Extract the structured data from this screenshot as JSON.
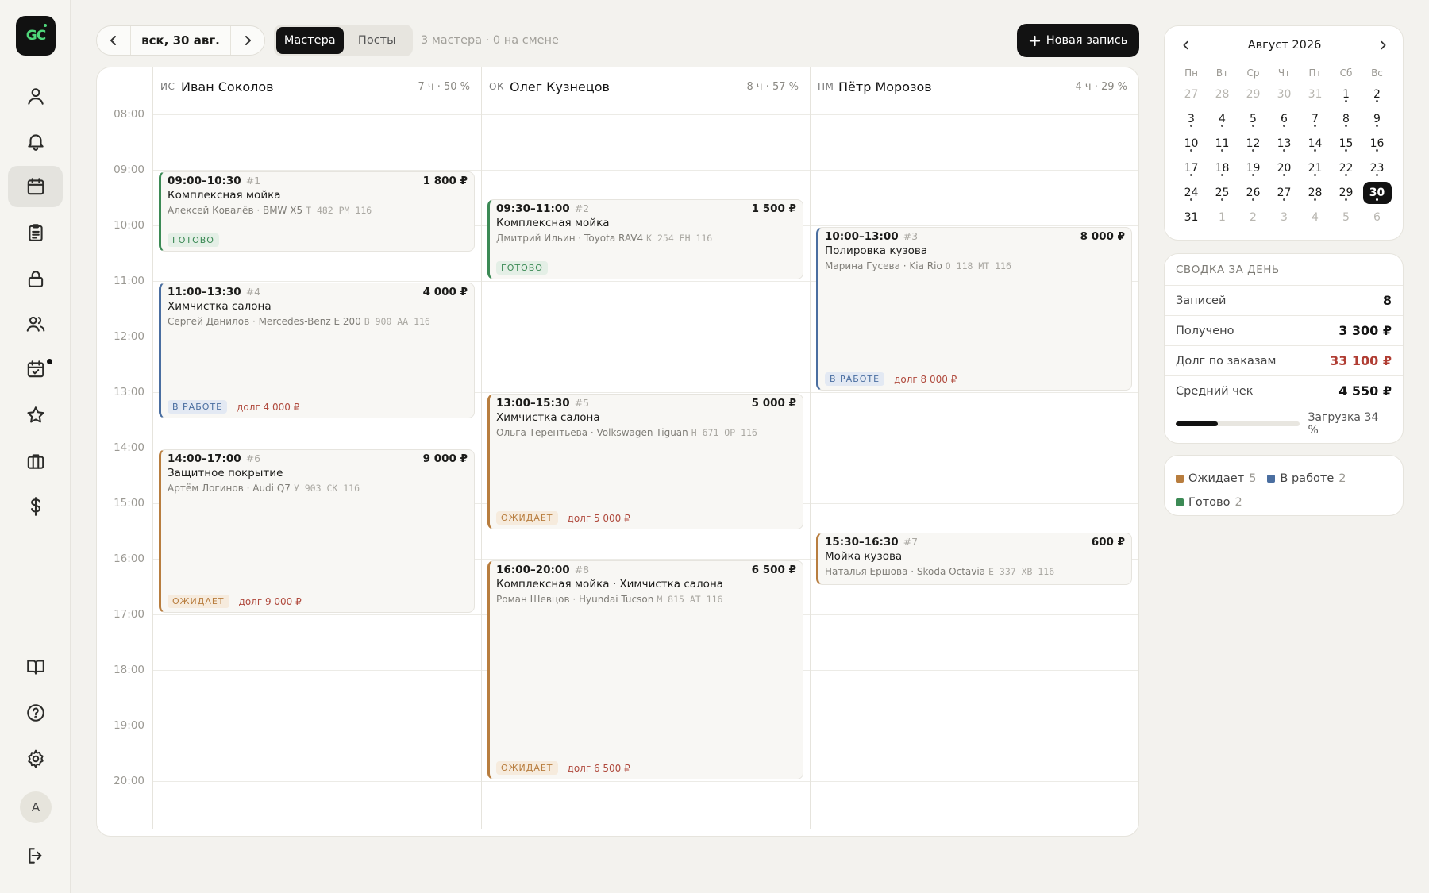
{
  "sidebar": {
    "logo": "GC",
    "avatar": "A",
    "items": [
      {
        "icon": "user-icon",
        "top": 0
      },
      {
        "icon": "bell-icon"
      },
      {
        "icon": "calendar-icon",
        "active": true
      },
      {
        "icon": "clipboard-icon"
      },
      {
        "icon": "lock-icon"
      },
      {
        "icon": "users-icon"
      },
      {
        "icon": "calendar-check-icon",
        "notification": true
      },
      {
        "icon": "star-icon"
      },
      {
        "icon": "briefcase-icon"
      },
      {
        "icon": "dollar-icon"
      }
    ],
    "bottom_items": [
      "book-icon",
      "help-icon",
      "settings-icon",
      "logout-icon"
    ]
  },
  "toolbar": {
    "date": "вск, 30 авг.",
    "view_tabs": [
      "Мастера",
      "Посты"
    ],
    "active_tab": "Мастера",
    "summary": "3 мастера · 0 на смене",
    "new_button": "Новая запись"
  },
  "schedule": {
    "hours": [
      "08:00",
      "09:00",
      "10:00",
      "11:00",
      "12:00",
      "13:00",
      "14:00",
      "15:00",
      "16:00",
      "17:00",
      "18:00",
      "19:00",
      "20:00"
    ],
    "masters": [
      {
        "initials": "ИС",
        "name": "Иван Соколов",
        "stats": "7 ч · 50 %"
      },
      {
        "initials": "ОК",
        "name": "Олег Кузнецов",
        "stats": "8 ч · 57 %"
      },
      {
        "initials": "ПМ",
        "name": "Пётр Морозов",
        "stats": "4 ч · 29 %"
      }
    ],
    "appointments": [
      {
        "master": 0,
        "start": 9.0,
        "end": 10.5,
        "time": "09:00–10:30",
        "num": "#1",
        "price": "1 800 ₽",
        "service": "Комплексная мойка",
        "client": "Алексей Ковалёв · BMW X5",
        "plate": "Т 482 РМ 116",
        "status": "ГОТОВО",
        "status_type": "done",
        "debt": ""
      },
      {
        "master": 0,
        "start": 11.0,
        "end": 13.5,
        "time": "11:00–13:30",
        "num": "#4",
        "price": "4 000 ₽",
        "service": "Химчистка салона",
        "client": "Сергей Данилов · Mercedes-Benz E 200",
        "plate": "В 900 АА 116",
        "status": "В РАБОТЕ",
        "status_type": "work",
        "debt": "долг 4 000 ₽"
      },
      {
        "master": 0,
        "start": 14.0,
        "end": 17.0,
        "time": "14:00–17:00",
        "num": "#6",
        "price": "9 000 ₽",
        "service": "Защитное покрытие",
        "client": "Артём Логинов · Audi Q7",
        "plate": "У 903 СК 116",
        "status": "ОЖИДАЕТ",
        "status_type": "wait",
        "debt": "долг 9 000 ₽"
      },
      {
        "master": 1,
        "start": 9.5,
        "end": 11.0,
        "time": "09:30–11:00",
        "num": "#2",
        "price": "1 500 ₽",
        "service": "Комплексная мойка",
        "client": "Дмитрий Ильин · Toyota RAV4",
        "plate": "К 254 ЕН 116",
        "status": "ГОТОВО",
        "status_type": "done",
        "debt": ""
      },
      {
        "master": 1,
        "start": 13.0,
        "end": 15.5,
        "time": "13:00–15:30",
        "num": "#5",
        "price": "5 000 ₽",
        "service": "Химчистка салона",
        "client": "Ольга Терентьева · Volkswagen Tiguan",
        "plate": "Н 671 ОР 116",
        "status": "ОЖИДАЕТ",
        "status_type": "wait",
        "debt": "долг 5 000 ₽"
      },
      {
        "master": 1,
        "start": 16.0,
        "end": 20.0,
        "time": "16:00–20:00",
        "num": "#8",
        "price": "6 500 ₽",
        "service": "Комплексная мойка · Химчистка салона",
        "client": "Роман Шевцов · Hyundai Tucson",
        "plate": "М 815 АТ 116",
        "status": "ОЖИДАЕТ",
        "status_type": "wait",
        "debt": "долг 6 500 ₽"
      },
      {
        "master": 2,
        "start": 10.0,
        "end": 13.0,
        "time": "10:00–13:00",
        "num": "#3",
        "price": "8 000 ₽",
        "service": "Полировка кузова",
        "client": "Марина Гусева · Kia Rio",
        "plate": "О 118 МТ 116",
        "status": "В РАБОТЕ",
        "status_type": "work",
        "debt": "долг 8 000 ₽"
      },
      {
        "master": 2,
        "start": 15.5,
        "end": 16.5,
        "time": "15:30–16:30",
        "num": "#7",
        "price": "600 ₽",
        "service": "Мойка кузова",
        "client": "Наталья Ершова · Skoda Octavia",
        "plate": "Е 337 ХВ 116",
        "status": "",
        "status_type": "wait",
        "debt": ""
      }
    ]
  },
  "calendar": {
    "month": "Август 2026",
    "weekdays": [
      "Пн",
      "Вт",
      "Ср",
      "Чт",
      "Пт",
      "Сб",
      "Вс"
    ],
    "days": [
      {
        "d": "27",
        "m": true
      },
      {
        "d": "28",
        "m": true
      },
      {
        "d": "29",
        "m": true
      },
      {
        "d": "30",
        "m": true
      },
      {
        "d": "31",
        "m": true
      },
      {
        "d": "1",
        "dot": true
      },
      {
        "d": "2",
        "dot": true
      },
      {
        "d": "3",
        "dot": true
      },
      {
        "d": "4",
        "dot": true
      },
      {
        "d": "5",
        "dot": true
      },
      {
        "d": "6",
        "dot": true
      },
      {
        "d": "7",
        "dot": true
      },
      {
        "d": "8",
        "dot": true
      },
      {
        "d": "9",
        "dot": true
      },
      {
        "d": "10",
        "dot": true
      },
      {
        "d": "11",
        "dot": true
      },
      {
        "d": "12",
        "dot": true
      },
      {
        "d": "13",
        "dot": true
      },
      {
        "d": "14",
        "dot": true
      },
      {
        "d": "15",
        "dot": true
      },
      {
        "d": "16",
        "dot": true
      },
      {
        "d": "17",
        "dot": true
      },
      {
        "d": "18",
        "dot": true
      },
      {
        "d": "19",
        "dot": true
      },
      {
        "d": "20",
        "dot": true
      },
      {
        "d": "21",
        "dot": true
      },
      {
        "d": "22",
        "dot": true
      },
      {
        "d": "23",
        "dot": true
      },
      {
        "d": "24",
        "dot": true
      },
      {
        "d": "25",
        "dot": true
      },
      {
        "d": "26",
        "dot": true
      },
      {
        "d": "27",
        "dot": true
      },
      {
        "d": "28",
        "dot": true
      },
      {
        "d": "29",
        "dot": true
      },
      {
        "d": "30",
        "dot": true,
        "sel": true
      },
      {
        "d": "31"
      },
      {
        "d": "1",
        "m": true
      },
      {
        "d": "2",
        "m": true
      },
      {
        "d": "3",
        "m": true
      },
      {
        "d": "4",
        "m": true
      },
      {
        "d": "5",
        "m": true
      },
      {
        "d": "6",
        "m": true
      }
    ]
  },
  "summary": {
    "title": "СВОДКА ЗА ДЕНЬ",
    "rows": [
      {
        "label": "Записей",
        "value": "8"
      },
      {
        "label": "Получено",
        "value": "3 300 ₽"
      },
      {
        "label": "Долг по заказам",
        "value": "33 100 ₽",
        "red": true
      },
      {
        "label": "Средний чек",
        "value": "4 550 ₽"
      }
    ],
    "load_label": "Загрузка 34 %",
    "load_fraction": 0.34
  },
  "legend": {
    "items": [
      {
        "label": "Ожидает",
        "count": "5",
        "color": "#b87d3e"
      },
      {
        "label": "В работе",
        "count": "2",
        "color": "#4a6ea0"
      },
      {
        "label": "Готово",
        "count": "2",
        "color": "#3c8a55"
      }
    ]
  },
  "colors": {
    "done": "#3c8a55",
    "work": "#4a6ea0",
    "wait": "#b87d3e"
  }
}
